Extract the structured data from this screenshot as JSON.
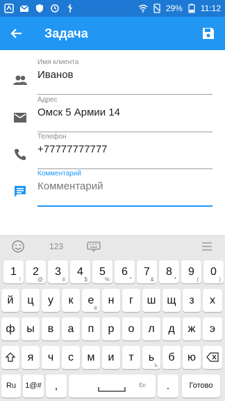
{
  "status_bar": {
    "battery": "29%",
    "time": "11:12"
  },
  "app_bar": {
    "title": "Задача",
    "back_icon": "arrow-back-icon",
    "save_icon": "save-icon"
  },
  "form": {
    "client": {
      "label": "Имя клиента",
      "value": "Иванов",
      "icon": "people-icon"
    },
    "address": {
      "label": "Адрес",
      "value": "Омск 5 Армии 14",
      "icon": "mail-icon"
    },
    "phone": {
      "label": "Телефон",
      "value": "+77777777777",
      "icon": "phone-icon"
    },
    "comment": {
      "label": "Комментарий",
      "placeholder": "Комментарий",
      "icon": "comment-icon"
    }
  },
  "keyboard": {
    "toolbar": {
      "numbers": "123"
    },
    "row1": [
      {
        "key": "1",
        "sub": "!"
      },
      {
        "key": "2",
        "sub": "@"
      },
      {
        "key": "3",
        "sub": "#"
      },
      {
        "key": "4",
        "sub": "$"
      },
      {
        "key": "5",
        "sub": "%"
      },
      {
        "key": "6",
        "sub": "^"
      },
      {
        "key": "7",
        "sub": "&"
      },
      {
        "key": "8",
        "sub": "*"
      },
      {
        "key": "9",
        "sub": "("
      },
      {
        "key": "0",
        "sub": ")"
      }
    ],
    "row2": [
      {
        "key": "й",
        "sub": ""
      },
      {
        "key": "ц",
        "sub": ""
      },
      {
        "key": "у",
        "sub": ""
      },
      {
        "key": "к",
        "sub": ""
      },
      {
        "key": "е",
        "sub": "ё"
      },
      {
        "key": "н",
        "sub": ""
      },
      {
        "key": "г",
        "sub": ""
      },
      {
        "key": "ш",
        "sub": ""
      },
      {
        "key": "щ",
        "sub": ""
      },
      {
        "key": "з",
        "sub": ""
      },
      {
        "key": "х",
        "sub": ""
      }
    ],
    "row3": [
      {
        "key": "ф",
        "sub": ""
      },
      {
        "key": "ы",
        "sub": ""
      },
      {
        "key": "в",
        "sub": ""
      },
      {
        "key": "а",
        "sub": ""
      },
      {
        "key": "п",
        "sub": ""
      },
      {
        "key": "р",
        "sub": ""
      },
      {
        "key": "о",
        "sub": ""
      },
      {
        "key": "л",
        "sub": ""
      },
      {
        "key": "д",
        "sub": ""
      },
      {
        "key": "ж",
        "sub": ""
      },
      {
        "key": "э",
        "sub": ""
      }
    ],
    "row4": [
      {
        "key": "я",
        "sub": ""
      },
      {
        "key": "ч",
        "sub": ""
      },
      {
        "key": "с",
        "sub": ""
      },
      {
        "key": "м",
        "sub": ""
      },
      {
        "key": "и",
        "sub": ""
      },
      {
        "key": "т",
        "sub": ""
      },
      {
        "key": "ь",
        "sub": "ъ"
      },
      {
        "key": "б",
        "sub": ""
      },
      {
        "key": "ю",
        "sub": ""
      }
    ],
    "bottom": {
      "lang": "Ru",
      "symbols": "1@#",
      "comma": ",",
      "space_lang": "En",
      "period": ".",
      "done": "Готово"
    }
  }
}
